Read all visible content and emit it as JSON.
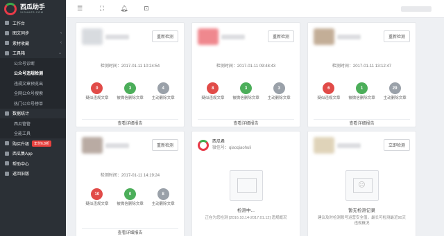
{
  "brand": {
    "name": "西瓜助手",
    "sub": "XIGUAZS.COM"
  },
  "sidebar": {
    "items": [
      {
        "label": "工作台",
        "type": "group"
      },
      {
        "label": "图文同步",
        "type": "group",
        "chev": "‹"
      },
      {
        "label": "素材收藏",
        "type": "group",
        "chev": "‹"
      },
      {
        "label": "工具箱",
        "type": "group",
        "chev": "⌄"
      },
      {
        "label": "公众号诊断",
        "type": "sub"
      },
      {
        "label": "公众号违规检测",
        "type": "sub active"
      },
      {
        "label": "违规文章预览出",
        "type": "sub"
      },
      {
        "label": "全网公众号搜索",
        "type": "sub"
      },
      {
        "label": "热门公众号榜单",
        "type": "sub"
      },
      {
        "label": "数据统计",
        "type": "group"
      },
      {
        "label": "西瓜管管",
        "type": "sub"
      },
      {
        "label": "全能工具",
        "type": "sub"
      },
      {
        "label": "购买升级",
        "type": "group",
        "badge": "年付6.8折"
      },
      {
        "label": "西瓜集App",
        "type": "group"
      },
      {
        "label": "帮助中心",
        "type": "group"
      },
      {
        "label": "返回旧版",
        "type": "group"
      }
    ]
  },
  "topbar": {
    "icons": [
      "menu-icon",
      "fullscreen-icon",
      "bell-icon",
      "gift-icon"
    ]
  },
  "cards": [
    {
      "recheck": "重新检测",
      "time": "检测时间：2017-01-11 10:24:54",
      "stats": [
        {
          "v": "0",
          "l": "疑似违规文章"
        },
        {
          "v": "3",
          "l": "被微信删除文章"
        },
        {
          "v": "4",
          "l": "主动删除文章"
        }
      ],
      "report": "查看详细报告"
    },
    {
      "recheck": "重新检测",
      "time": "检测时间：2017-01-11 09:48:43",
      "stats": [
        {
          "v": "8",
          "l": "疑似违规文章"
        },
        {
          "v": "3",
          "l": "被微信删除文章"
        },
        {
          "v": "3",
          "l": "主动删除文章"
        }
      ],
      "report": "查看详细报告"
    },
    {
      "recheck": "重新检测",
      "time": "检测时间：2017-01-11 13:12:47",
      "stats": [
        {
          "v": "6",
          "l": "疑似违规文章"
        },
        {
          "v": "1",
          "l": "被微信删除文章"
        },
        {
          "v": "29",
          "l": "主动删除文章"
        }
      ],
      "report": "查看详细报告"
    },
    {
      "recheck": "重新检测",
      "time": "检测时间：2017-01-11 14:19:24",
      "stats": [
        {
          "v": "10",
          "l": "疑似违规文章"
        },
        {
          "v": "0",
          "l": "被微信删除文章"
        },
        {
          "v": "8",
          "l": "主动删除文章"
        }
      ],
      "report": "查看详细报告"
    }
  ],
  "checking": {
    "name": "西瓜君",
    "id": "微信号：qiaoqiaohuli",
    "status": "检测中...",
    "desc": "正在为您检测 [2016.10.14-2017.01.12] 违规概况"
  },
  "empty": {
    "button": "立即检测",
    "status": "暂无检测记录",
    "desc": "建议及时检测账号运营安全值，最长可检测最近90天违规概况"
  },
  "colors": {
    "red": "#e14b48",
    "green": "#4cae5a",
    "gray": "#9aa1a9"
  }
}
